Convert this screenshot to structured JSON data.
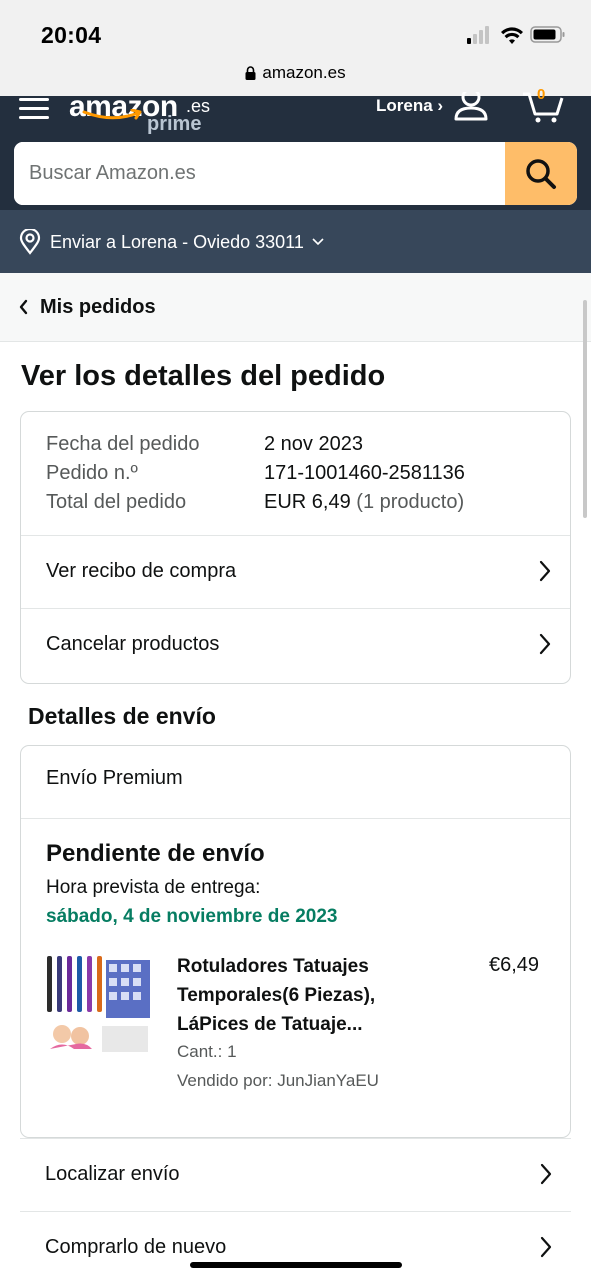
{
  "status_bar": {
    "time": "20:04"
  },
  "browser": {
    "url": "amazon.es"
  },
  "header": {
    "logo_text": "amazon",
    "logo_suffix": ".es",
    "logo_prime": "prime",
    "account_label": "Lorena ›",
    "cart_count": "0",
    "search": {
      "placeholder": "Buscar Amazon.es",
      "value": ""
    },
    "deliver_to": "Enviar a Lorena - Oviedo 33011"
  },
  "breadcrumb": {
    "label": "Mis pedidos"
  },
  "page": {
    "title": "Ver los detalles del pedido"
  },
  "order_summary": {
    "date_label": "Fecha del pedido",
    "date_value": "2 nov 2023",
    "number_label": "Pedido n.º",
    "number_value": "171-1001460-2581136",
    "total_label": "Total del pedido",
    "total_value": "EUR 6,49",
    "total_count": "(1 producto)",
    "actions": [
      "Ver recibo de compra",
      "Cancelar productos"
    ]
  },
  "shipping": {
    "section_title": "Detalles de envío",
    "method": "Envío Premium",
    "status": "Pendiente de envío",
    "eta_label": "Hora prevista de entrega:",
    "eta_date": "sábado, 4 de noviembre de 2023",
    "product": {
      "title": "Rotuladores Tatuajes Temporales(6 Piezas), LáPices de Tatuaje...",
      "price": "€6,49",
      "qty": "Cant.: 1",
      "seller": "Vendido por: JunJianYaEU"
    }
  },
  "list_actions": [
    "Localizar envío",
    "Comprarlo de nuevo"
  ],
  "colors": {
    "header_dark": "#232f3e",
    "header_sub": "#37475a",
    "search_button": "#febd69",
    "eta_green": "#067d62"
  }
}
